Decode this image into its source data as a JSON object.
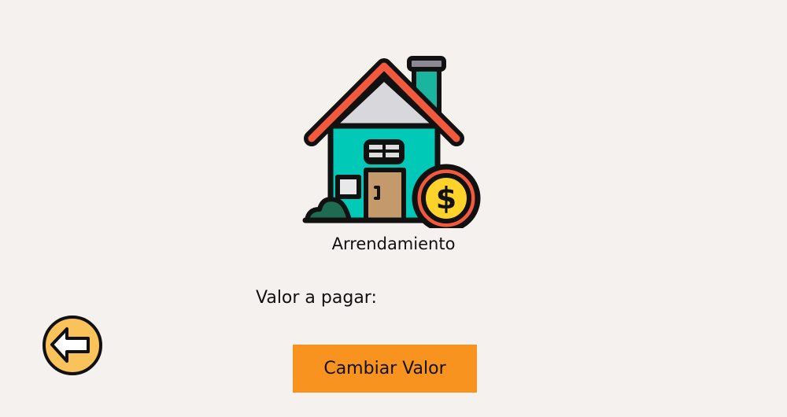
{
  "header": {
    "title": "Arrendamiento",
    "icon": "house-rent-icon"
  },
  "form": {
    "value_label": "Valor a pagar:",
    "change_button": "Cambiar Valor"
  },
  "nav": {
    "back_icon": "back-arrow-icon"
  },
  "colors": {
    "background": "#f4f1ee",
    "button": "#f7931e",
    "back_circle": "#f9c25a"
  }
}
